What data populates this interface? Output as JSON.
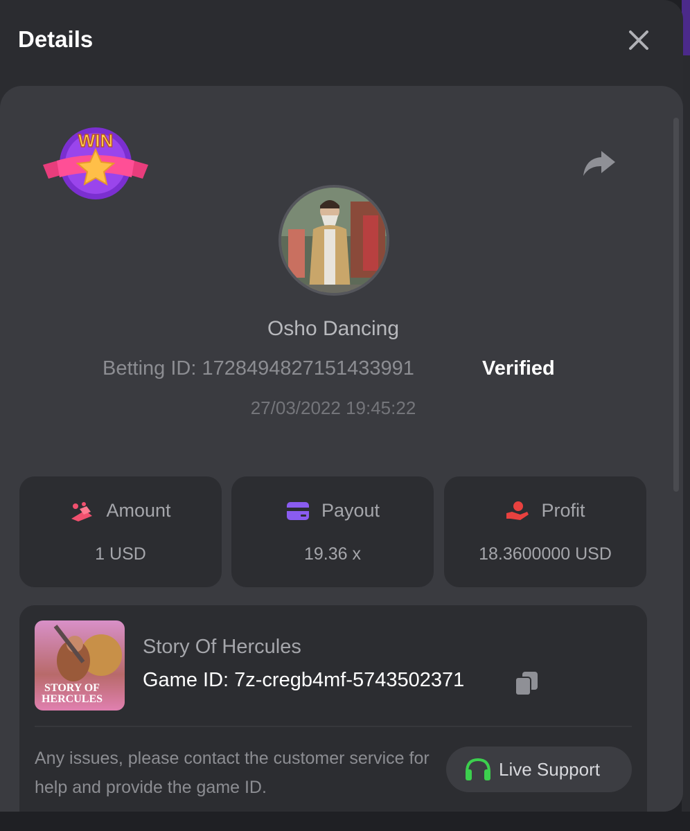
{
  "header": {
    "title": "Details"
  },
  "bet": {
    "game_name": "Osho Dancing",
    "betting_id": "Betting ID: 1728494827151433991",
    "status": "Verified",
    "datetime": "27/03/2022 19:45:22",
    "badge_text": "WIN"
  },
  "stats": [
    {
      "label": "Amount",
      "value": "1 USD",
      "icon": "coins-icon",
      "color": "#f0506e"
    },
    {
      "label": "Payout",
      "value": "19.36 x",
      "icon": "wallet-card-icon",
      "color": "#8a5cf0"
    },
    {
      "label": "Profit",
      "value": "18.3600000 USD",
      "icon": "hand-money-icon",
      "color": "#e8413f"
    }
  ],
  "game": {
    "title": "Story Of Hercules",
    "game_id": "Game ID: 7z-cregb4mf-5743502371",
    "thumb_text_line1": "STORY OF",
    "thumb_text_line2": "HERCULES"
  },
  "support": {
    "help_text": "Any issues, please contact the customer service for help and provide the game ID.",
    "button_label": "Live Support",
    "icon_color": "#3ccf4e"
  }
}
